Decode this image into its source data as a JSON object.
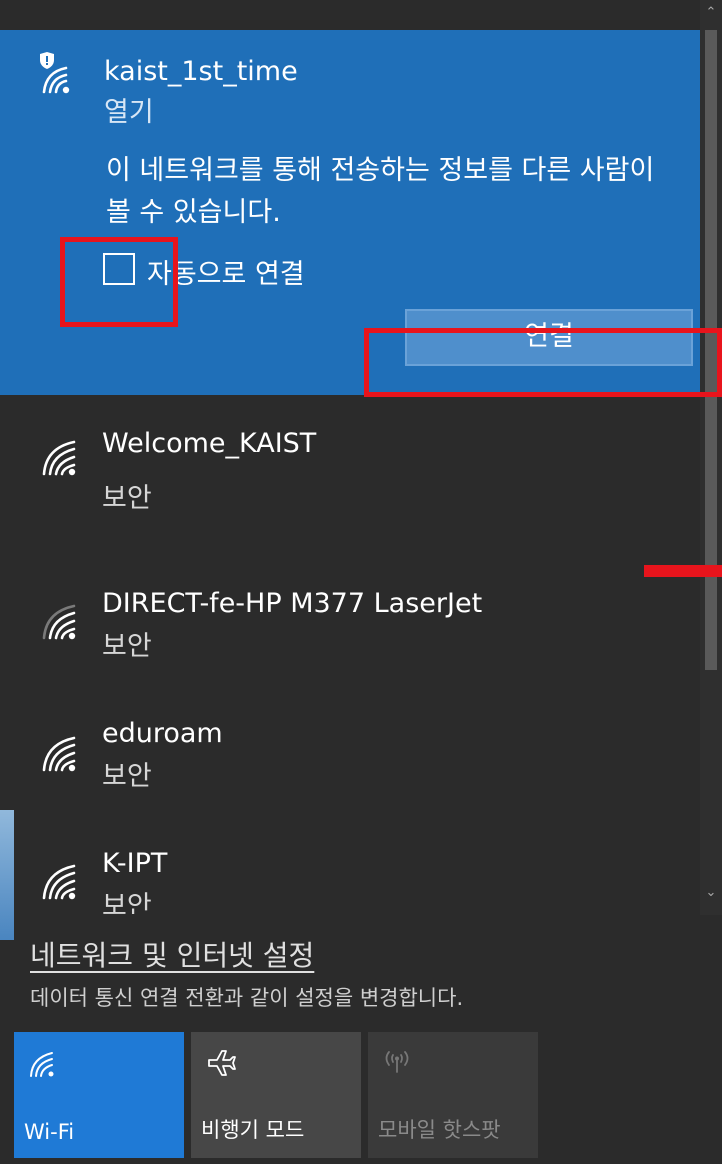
{
  "selected_network": {
    "name": "kaist_1st_time",
    "status": "열기",
    "warning": "이 네트워크를 통해 전송하는 정보를 다른 사람이 볼 수 있습니다.",
    "auto_connect_label": "자동으로 연결",
    "auto_connect_checked": false,
    "connect_label": "연결"
  },
  "networks": [
    {
      "name": "Welcome_KAIST",
      "status": "보안"
    },
    {
      "name": "DIRECT-fe-HP M377 LaserJet",
      "status": "보안"
    },
    {
      "name": "eduroam",
      "status": "보안"
    },
    {
      "name": "K-IPT",
      "status": "보안"
    }
  ],
  "settings": {
    "link": "네트워크 및 인터넷 설정",
    "description": "데이터 통신 연결 전환과 같이 설정을 변경합니다."
  },
  "quick_actions": [
    {
      "label": "Wi-Fi",
      "icon": "wifi-icon",
      "active": true
    },
    {
      "label": "비행기 모드",
      "icon": "airplane-icon",
      "active": false
    },
    {
      "label": "모바일 핫스팟",
      "icon": "hotspot-icon",
      "active": false,
      "disabled": true
    }
  ],
  "colors": {
    "panel_bg": "#2b2b2b",
    "selected_bg": "#1f6fb8",
    "accent": "#1f7ad6",
    "annotation_red": "#e8141c"
  }
}
